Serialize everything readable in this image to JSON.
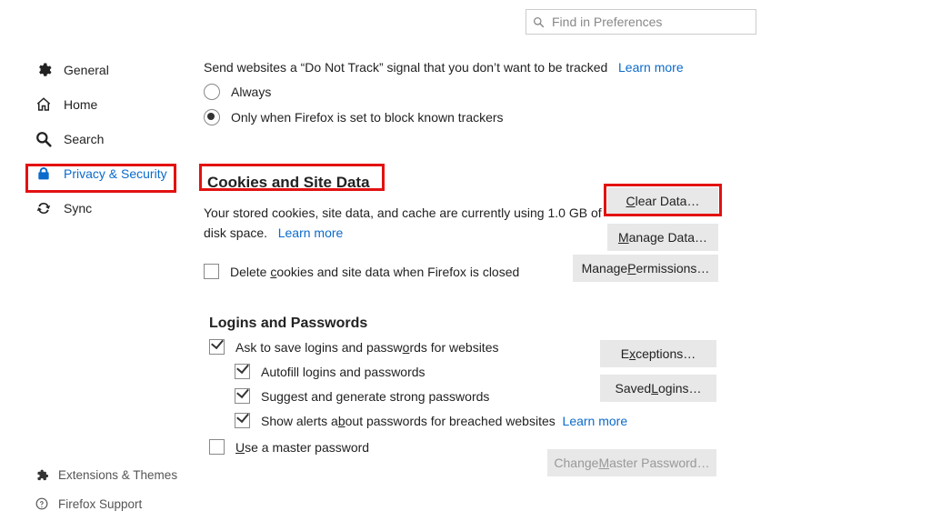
{
  "search": {
    "placeholder": "Find in Preferences"
  },
  "sidebar": {
    "items": [
      {
        "label": "General"
      },
      {
        "label": "Home"
      },
      {
        "label": "Search"
      },
      {
        "label": "Privacy & Security"
      },
      {
        "label": "Sync"
      }
    ]
  },
  "bottom": {
    "extensions": "Extensions & Themes",
    "support": "Firefox Support"
  },
  "dnt": {
    "text": "Send websites a “Do Not Track” signal that you don’t want to be tracked",
    "learn_more": "Learn more",
    "option_always": "Always",
    "option_block": "Only when Firefox is set to block known trackers"
  },
  "cookies": {
    "heading": "Cookies and Site Data",
    "desc": "Your stored cookies, site data, and cache are currently using 1.0 GB of disk space.",
    "learn_more": "Learn more",
    "delete_on_close_pre": "Delete ",
    "delete_on_close_u": "c",
    "delete_on_close_post": "ookies and site data when Firefox is closed",
    "btn_clear_pre": "",
    "btn_clear_u": "C",
    "btn_clear_post": "lear Data…",
    "btn_manage_pre": "",
    "btn_manage_u": "M",
    "btn_manage_post": "anage Data…",
    "btn_perm_pre": "Manage ",
    "btn_perm_u": "P",
    "btn_perm_post": "ermissions…"
  },
  "logins": {
    "heading": "Logins and Passwords",
    "ask_save_pre": "Ask to save logins and passw",
    "ask_save_u": "o",
    "ask_save_post": "rds for websites",
    "autofill": "Autofill logins and passwords",
    "suggest_pre": "Su",
    "suggest_u": "g",
    "suggest_post": "gest and generate strong passwords",
    "alerts_pre": "Show alerts a",
    "alerts_u": "b",
    "alerts_post": "out passwords for breached websites",
    "alerts_learn_more": "Learn more",
    "master_pre": "",
    "master_u": "U",
    "master_post": "se a master password",
    "btn_exc_pre": "E",
    "btn_exc_u": "x",
    "btn_exc_post": "ceptions…",
    "btn_saved_pre": "Saved ",
    "btn_saved_u": "L",
    "btn_saved_post": "ogins…",
    "btn_change_pre": "Change ",
    "btn_change_u": "M",
    "btn_change_post": "aster Password…"
  }
}
